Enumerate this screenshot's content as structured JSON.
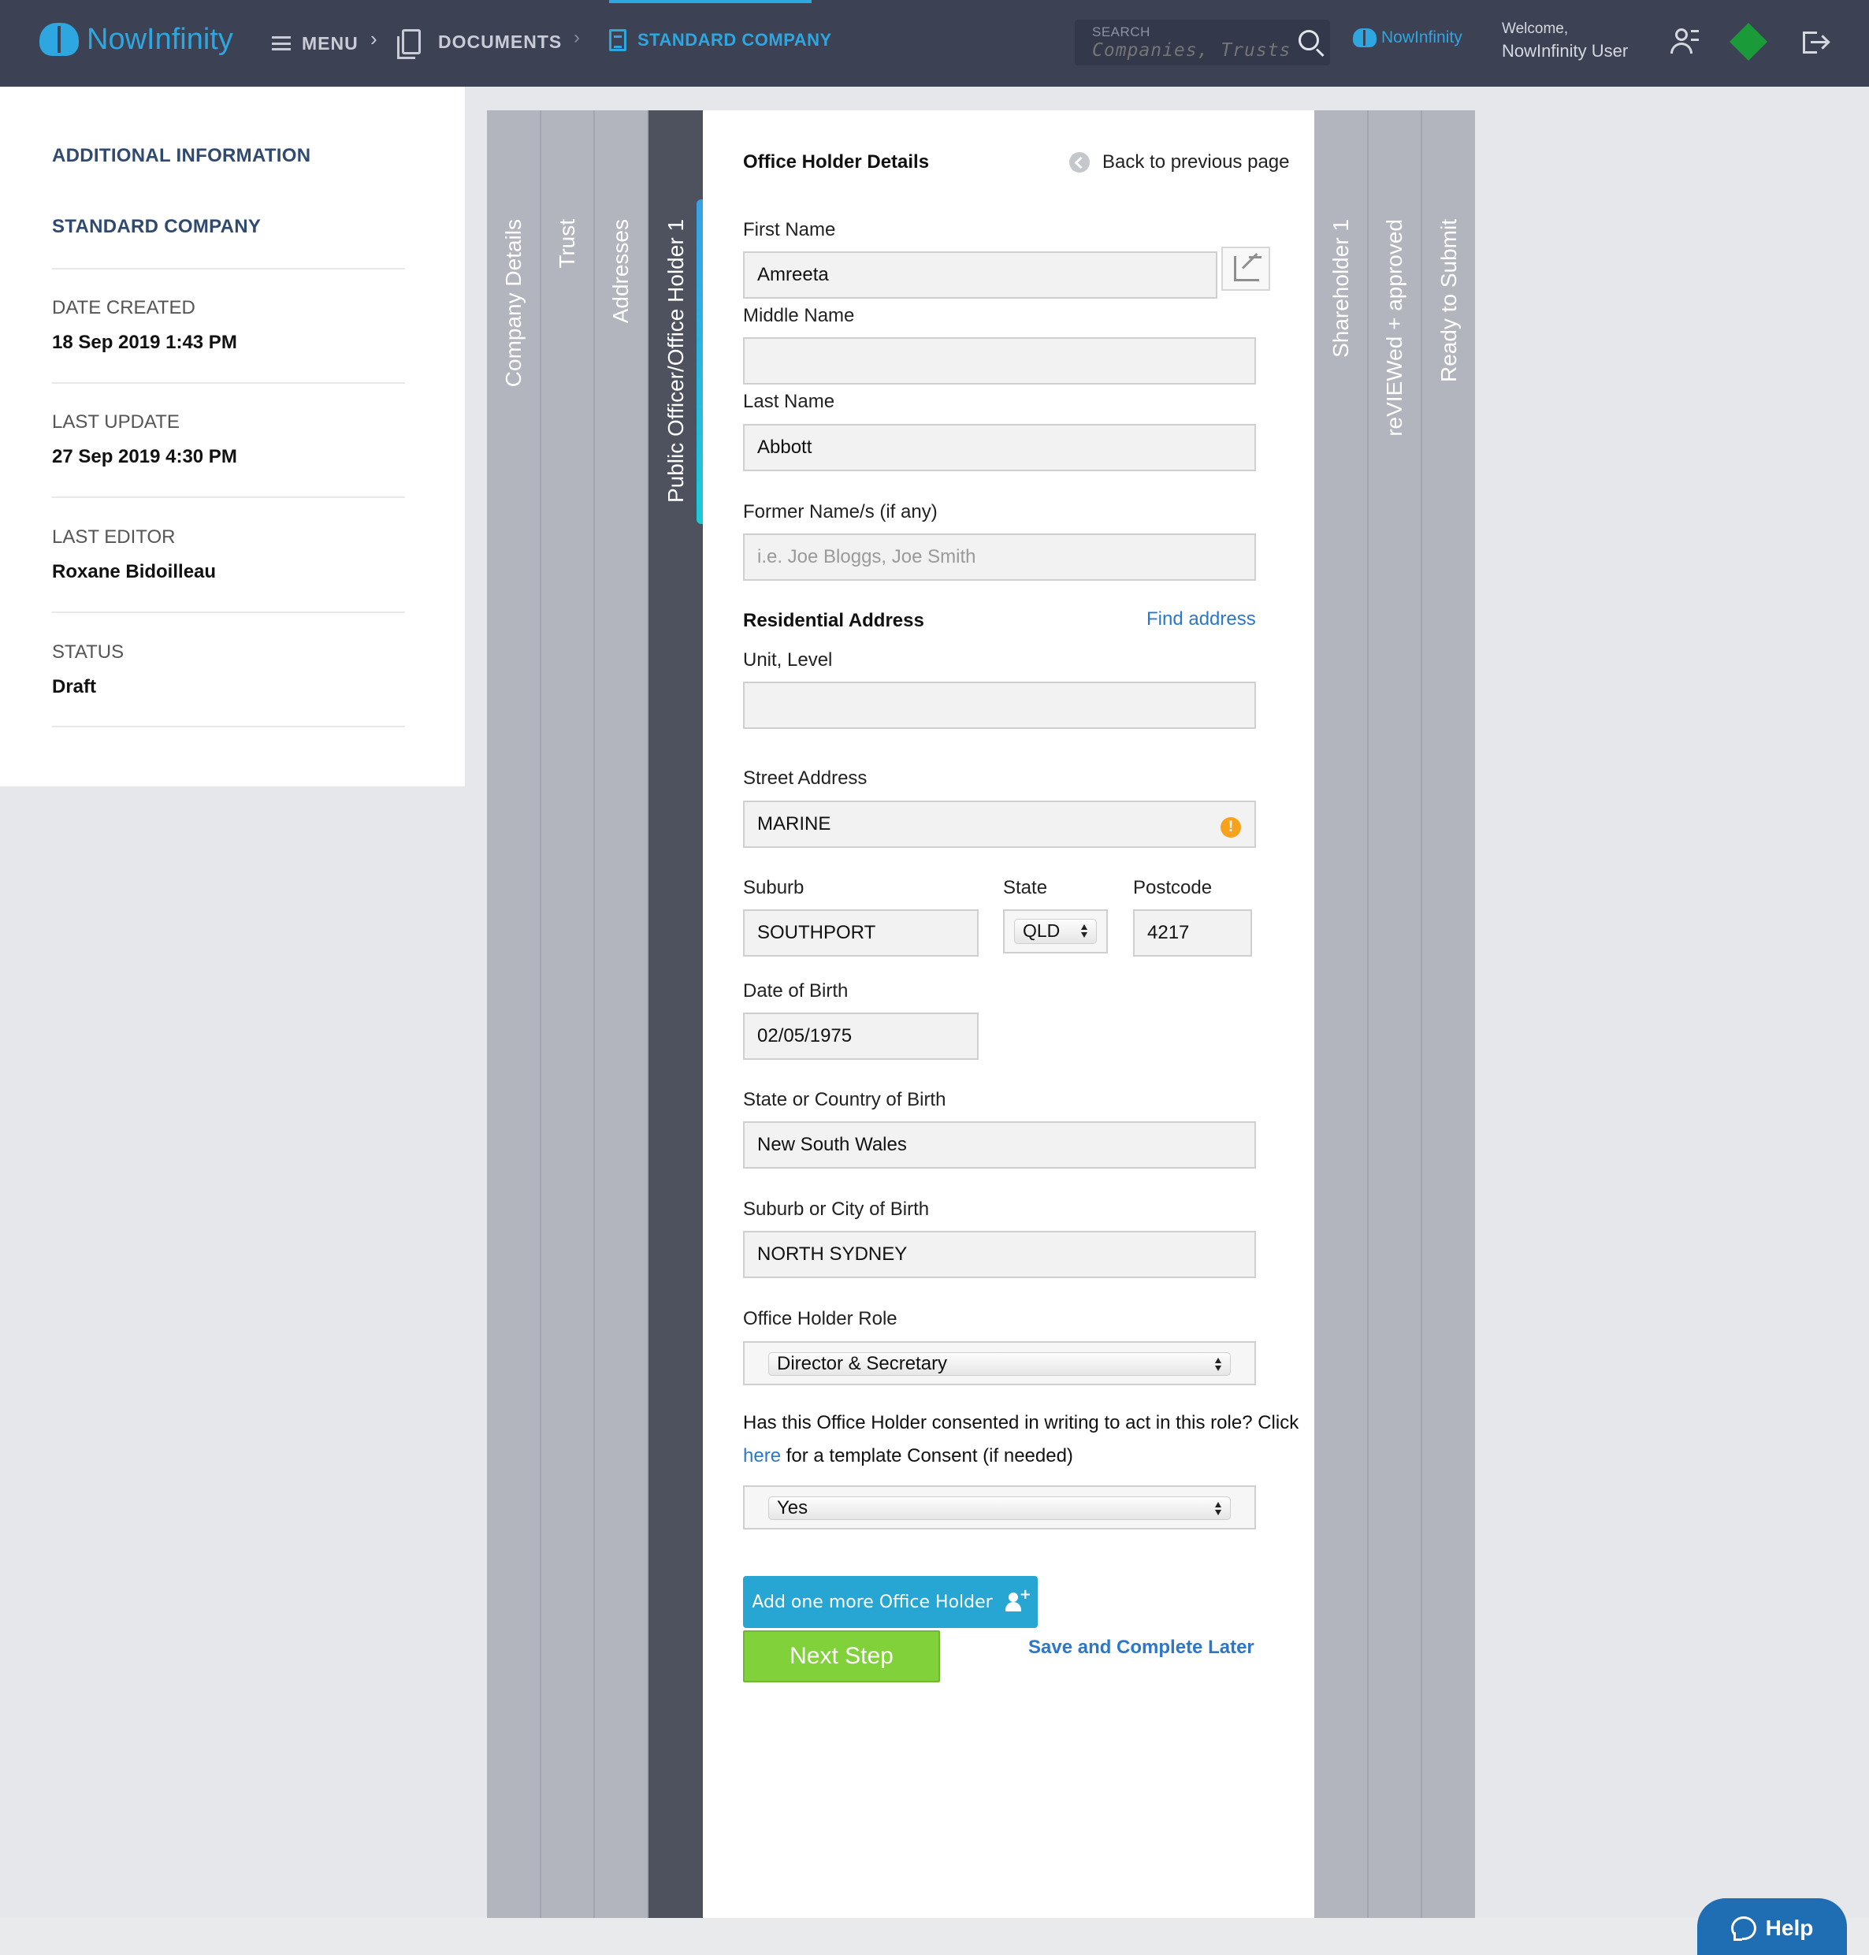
{
  "header": {
    "logo_text": "NowInfinity",
    "menu_label": "MENU",
    "breadcrumb_sep": "›",
    "documents_label": "DOCUMENTS",
    "active_label": "STANDARD COMPANY",
    "search_label": "SEARCH",
    "search_placeholder": "Companies, Trusts, Do",
    "logo_small": "NowInfinity",
    "welcome_line": "Welcome,",
    "user_name": "NowInfinity User",
    "accent_color": "#2ea6e0",
    "status_color": "#1a9a38"
  },
  "info": {
    "heading": "ADDITIONAL INFORMATION",
    "entity": "STANDARD COMPANY",
    "date_created_label": "DATE CREATED",
    "date_created": "18 Sep 2019 1:43 PM",
    "last_update_label": "LAST UPDATE",
    "last_update": "27 Sep 2019 4:30 PM",
    "last_editor_label": "LAST EDITOR",
    "last_editor": "Roxane Bidoilleau",
    "status_label": "STATUS",
    "status": "Draft"
  },
  "tabs": {
    "left": [
      "Company Details",
      "Trust",
      "Addresses"
    ],
    "active": "Public Officer/Office Holder 1",
    "right": [
      "Shareholder 1",
      "reVIEWed + approved",
      "Ready to Submit"
    ]
  },
  "form": {
    "title": "Office Holder Details",
    "back_label": "Back to previous page",
    "first_name_label": "First Name",
    "first_name": "Amreeta",
    "middle_name_label": "Middle Name",
    "middle_name": "",
    "last_name_label": "Last Name",
    "last_name": "Abbott",
    "former_names_label": "Former Name/s (if any)",
    "former_names_placeholder": "i.e. Joe Bloggs, Joe Smith",
    "address_title": "Residential Address",
    "find_address": "Find address",
    "unit_label": "Unit, Level",
    "unit": "",
    "street_label": "Street Address",
    "street": "MARINE",
    "warning_glyph": "!",
    "suburb_label": "Suburb",
    "suburb": "SOUTHPORT",
    "state_label": "State",
    "state": "QLD",
    "postcode_label": "Postcode",
    "postcode": "4217",
    "dob_label": "Date of Birth",
    "dob": "02/05/1975",
    "birth_state_label": "State or Country of Birth",
    "birth_state": "New South Wales",
    "birth_city_label": "Suburb or City of Birth",
    "birth_city": "NORTH SYDNEY",
    "role_label": "Office Holder Role",
    "role": "Director & Secretary",
    "consent_before": "Has this Office Holder consented in writing to act in this role? Click ",
    "consent_link": "here",
    "consent_after": " for a template Consent (if needed)",
    "consent_value": "Yes",
    "add_button": "Add one more Office Holder",
    "add_plus": "+",
    "next_button": "Next Step",
    "save_later": "Save and Complete Later"
  },
  "help": {
    "label": "Help"
  }
}
